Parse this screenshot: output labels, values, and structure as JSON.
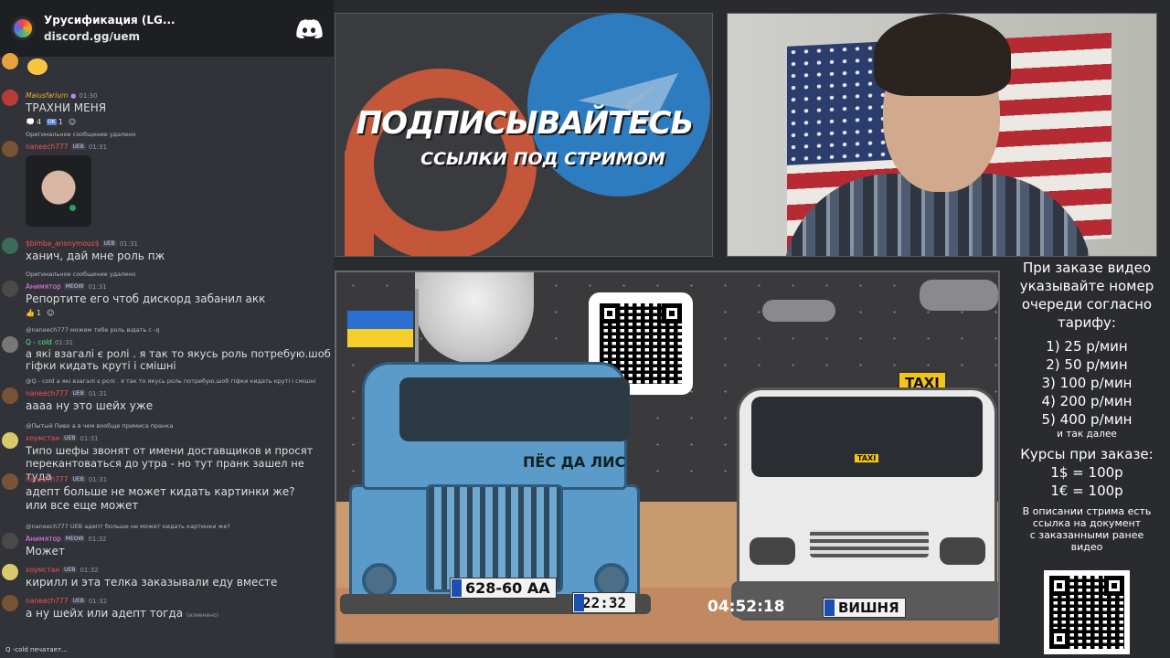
{
  "discord_header": {
    "server_name": "Урусификация (LG...",
    "invite": "discord.gg/uem"
  },
  "chat": {
    "messages": [
      {
        "name": "",
        "text": ""
      },
      {
        "name": "Maiusfarium",
        "time": "01:30",
        "text": "ТРАХНИ МЕНЯ",
        "reactions": [
          "4",
          "1"
        ]
      },
      {
        "reply": "Оригинальное сообщение удалено",
        "name": "naneech777",
        "badge": "UEB",
        "time": "01:31",
        "image": true
      },
      {
        "name": "$bimba_anonymous$",
        "badge": "UEB",
        "time": "01:31",
        "text": "ханич, дай мне роль пж"
      },
      {
        "reply": "Оригинальное сообщение удалено",
        "name": "Анимятор",
        "badge": "MEOW",
        "time": "01:31",
        "text": "Репортите его чтоб дискорд забанил акк",
        "reactions": [
          "1"
        ]
      },
      {
        "reply": "@naneech777 можем тебе роль відать с -q",
        "name": "Q - cold",
        "time": "01:31",
        "text": "а які взагалі є ролі . я так то якусь роль потребую.шоб гіфки кидать круті і смішні"
      },
      {
        "reply": "@Q - cold а які взагалі є ролі . я так то якусь роль потребую.шоб гіфки кидать круті і смішні",
        "name": "naneech777",
        "badge": "UEB",
        "time": "01:31",
        "text": "аааа ну это шейх уже"
      },
      {
        "reply": "@Пытый Пиво а в чем вообще примиса пранка",
        "name": "хоумстан",
        "badge": "UEB",
        "time": "01:31",
        "text": "Типо шефы звонят от имени доставщиков и просят перекантоваться до утра - но тут пранк зашел не туда"
      },
      {
        "name": "naneech777",
        "badge": "UEB",
        "time": "01:31",
        "text": "адепт больше не может кидать картинки же?",
        "text2": "или все еще может"
      },
      {
        "reply": "@naneech777 UEB адепт больше не может кидать картинки же?",
        "name": "Анимятор",
        "badge": "MEOW",
        "time": "01:32",
        "text": "Может"
      },
      {
        "name": "хоумстан",
        "badge": "UEB",
        "time": "01:32",
        "text": "кирилл и эта телка заказывали еду вместе"
      },
      {
        "name": "naneech777",
        "badge": "UEB",
        "time": "01:32",
        "text": "а ну шейх или адепт тогда",
        "edited": "(изменено)"
      }
    ],
    "typing": "Q -cold печатает..."
  },
  "banner": {
    "title": "ПОДПИСЫВАЙТЕСЬ",
    "subtitle": "ССЫЛКИ ПОД СТРИМОМ"
  },
  "scene": {
    "truck_label": "ПЁС ДА ЛИС",
    "truck_plate": "628-60 AA",
    "truck_plate_region": "UA",
    "timer_left": "22:32",
    "timer_right": "04:52:18",
    "van_plate": "ВИШНЯ",
    "taxi_sign": "TAXI",
    "taxi_small": "TAXI"
  },
  "info": {
    "l1": "При заказе видео",
    "l2": "указывайте номер",
    "l3": "очереди согласно",
    "l4": "тарифу:",
    "r1": "1) 25 р/мин",
    "r2": "2) 50 р/мин",
    "r3": "3) 100 р/мин",
    "r4": "4) 200 р/мин",
    "r5": "5) 400 р/мин",
    "r6": "и так далее",
    "c1": "Курсы при заказе:",
    "c2": "1$ = 100р",
    "c3": "1€ = 100р",
    "d1": "В описании стрима есть",
    "d2": "ссылка на документ",
    "d3": "с заказанными ранее",
    "d4": "видео"
  },
  "colors": {
    "discord_bg": "#313338",
    "header_bg": "#1e1f22",
    "telegram_blue": "#2e7cc0",
    "patreon_orange": "#c4563a",
    "truck_blue": "#5a9bc9",
    "name_red": "#f2555a",
    "name_green": "#57f287"
  }
}
